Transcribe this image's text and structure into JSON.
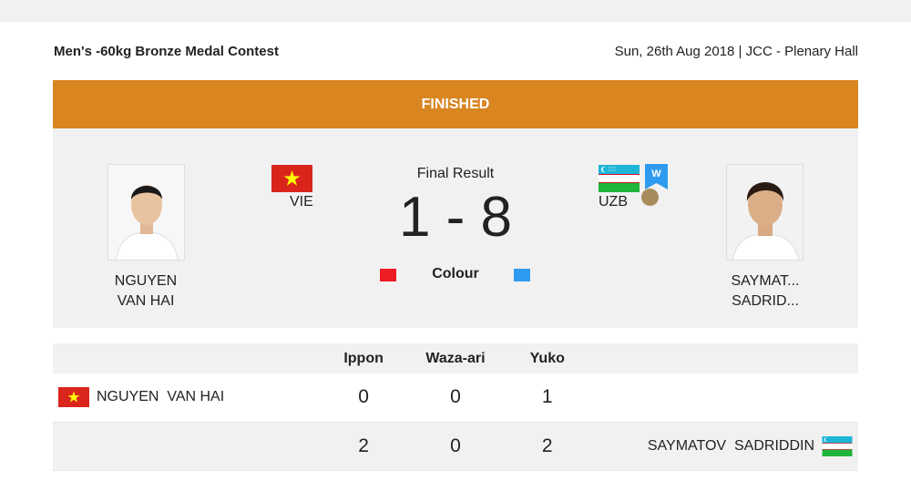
{
  "match": {
    "title": "Men's -60kg Bronze Medal Contest",
    "venue": "Sun, 26th Aug 2018 | JCC - Plenary Hall",
    "status": "FINISHED"
  },
  "result": {
    "label": "Final Result",
    "score": "1 - 8",
    "colour_label": "Colour",
    "winner_badge": "W"
  },
  "athletes": {
    "left": {
      "name_line1": "NGUYEN",
      "name_line2": "VAN HAI",
      "code": "VIE",
      "full_name": "NGUYEN  VAN HAI",
      "colour": "#ee1c24"
    },
    "right": {
      "name_line1": "SAYMAT...",
      "name_line2": "SADRID...",
      "code": "UZB",
      "full_name": "SAYMATOV  SADRIDDIN",
      "colour": "#2f9bf0"
    }
  },
  "table": {
    "headers": [
      "Ippon",
      "Waza-ari",
      "Yuko"
    ],
    "rows": [
      {
        "ippon": "0",
        "waza_ari": "0",
        "yuko": "1"
      },
      {
        "ippon": "2",
        "waza_ari": "0",
        "yuko": "2"
      }
    ]
  },
  "colors": {
    "accent": "#d98520",
    "panel": "#f1f1f1"
  }
}
